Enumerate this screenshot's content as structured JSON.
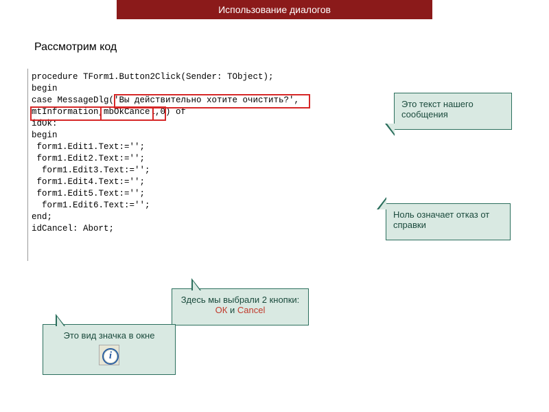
{
  "title": "Использование диалогов",
  "heading": "Рассмотрим код",
  "code": "procedure TForm1.Button2Click(Sender: TObject);\nbegin\ncase MessageDlg('Вы действительно хотите очистить?',\nmtInformation,mbOkCancel,0) of\nidOk:\nbegin\n form1.Edit1.Text:='';\n form1.Edit2.Text:='';\n  form1.Edit3.Text:='';\n form1.Edit4.Text:='';\n form1.Edit5.Text:='';\n  form1.Edit6.Text:='';\nend;\nidCancel: Abort;",
  "callouts": {
    "c1": "Это текст нашего сообщения",
    "c2": "Ноль означает отказ от справки",
    "c3_prefix": "Здесь мы выбрали 2 кнопки: ",
    "c3_ok": "ОК",
    "c3_and": " и ",
    "c3_cancel": "Cancel",
    "c4": "Это вид значка в окне"
  },
  "info_icon_glyph": "i"
}
